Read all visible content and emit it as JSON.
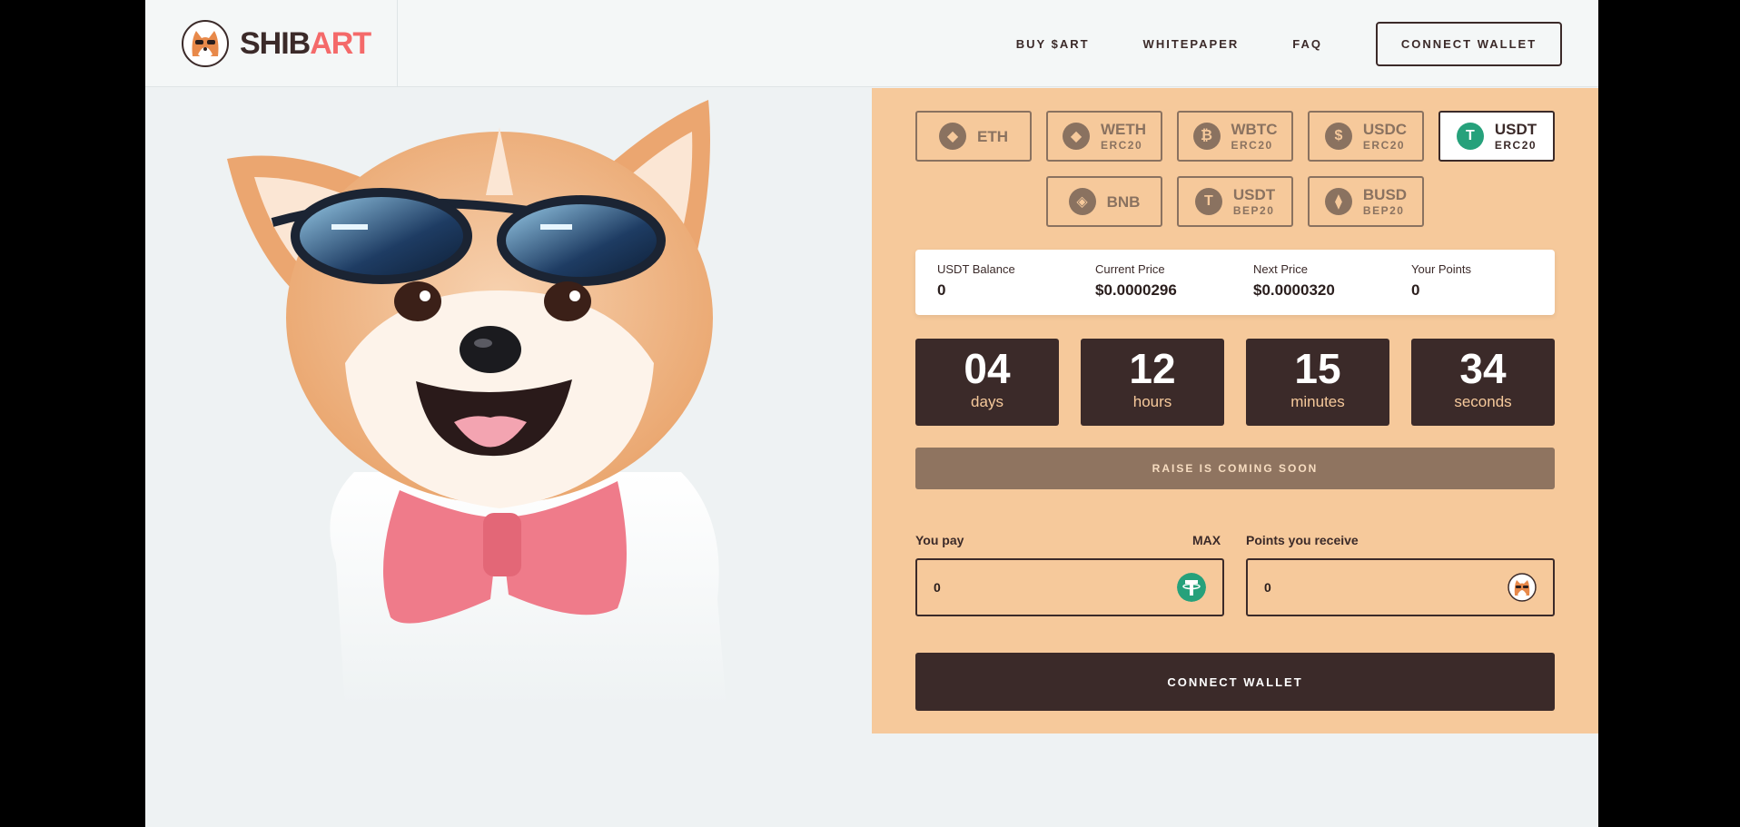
{
  "header": {
    "logo_text_a": "SHIB",
    "logo_text_b": "ART",
    "nav": [
      "BUY $ART",
      "WHITEPAPER",
      "FAQ"
    ],
    "connect_label": "CONNECT WALLET"
  },
  "tokens": [
    {
      "name": "ETH",
      "network": "",
      "icon": "ethereum-icon",
      "glyph": "◆",
      "active": false
    },
    {
      "name": "WETH",
      "network": "ERC20",
      "icon": "weth-icon",
      "glyph": "◆",
      "active": false
    },
    {
      "name": "WBTC",
      "network": "ERC20",
      "icon": "bitcoin-icon",
      "glyph": "₿",
      "active": false
    },
    {
      "name": "USDC",
      "network": "ERC20",
      "icon": "usdc-icon",
      "glyph": "$",
      "active": false
    },
    {
      "name": "USDT",
      "network": "ERC20",
      "icon": "tether-icon",
      "glyph": "T",
      "active": true
    },
    {
      "name": "BNB",
      "network": "",
      "icon": "bnb-icon",
      "glyph": "◈",
      "active": false
    },
    {
      "name": "USDT",
      "network": "BEP20",
      "icon": "tether-icon",
      "glyph": "T",
      "active": false
    },
    {
      "name": "BUSD",
      "network": "BEP20",
      "icon": "busd-icon",
      "glyph": "⧫",
      "active": false
    }
  ],
  "stats": [
    {
      "label": "USDT Balance",
      "value": "0"
    },
    {
      "label": "Current Price",
      "value": "$0.0000296"
    },
    {
      "label": "Next Price",
      "value": "$0.0000320"
    },
    {
      "label": "Your Points",
      "value": "0"
    }
  ],
  "countdown": [
    {
      "value": "04",
      "unit": "days"
    },
    {
      "value": "12",
      "unit": "hours"
    },
    {
      "value": "15",
      "unit": "minutes"
    },
    {
      "value": "34",
      "unit": "seconds"
    }
  ],
  "raise_label": "RAISE IS COMING SOON",
  "pay": {
    "label": "You pay",
    "max_label": "MAX",
    "value": "0"
  },
  "receive": {
    "label": "Points you receive",
    "value": "0"
  },
  "main_connect_label": "CONNECT WALLET",
  "colors": {
    "accent": "#f46a6a",
    "brown": "#3b2a29",
    "peach": "#f6c99b",
    "tether": "#26a17b"
  }
}
